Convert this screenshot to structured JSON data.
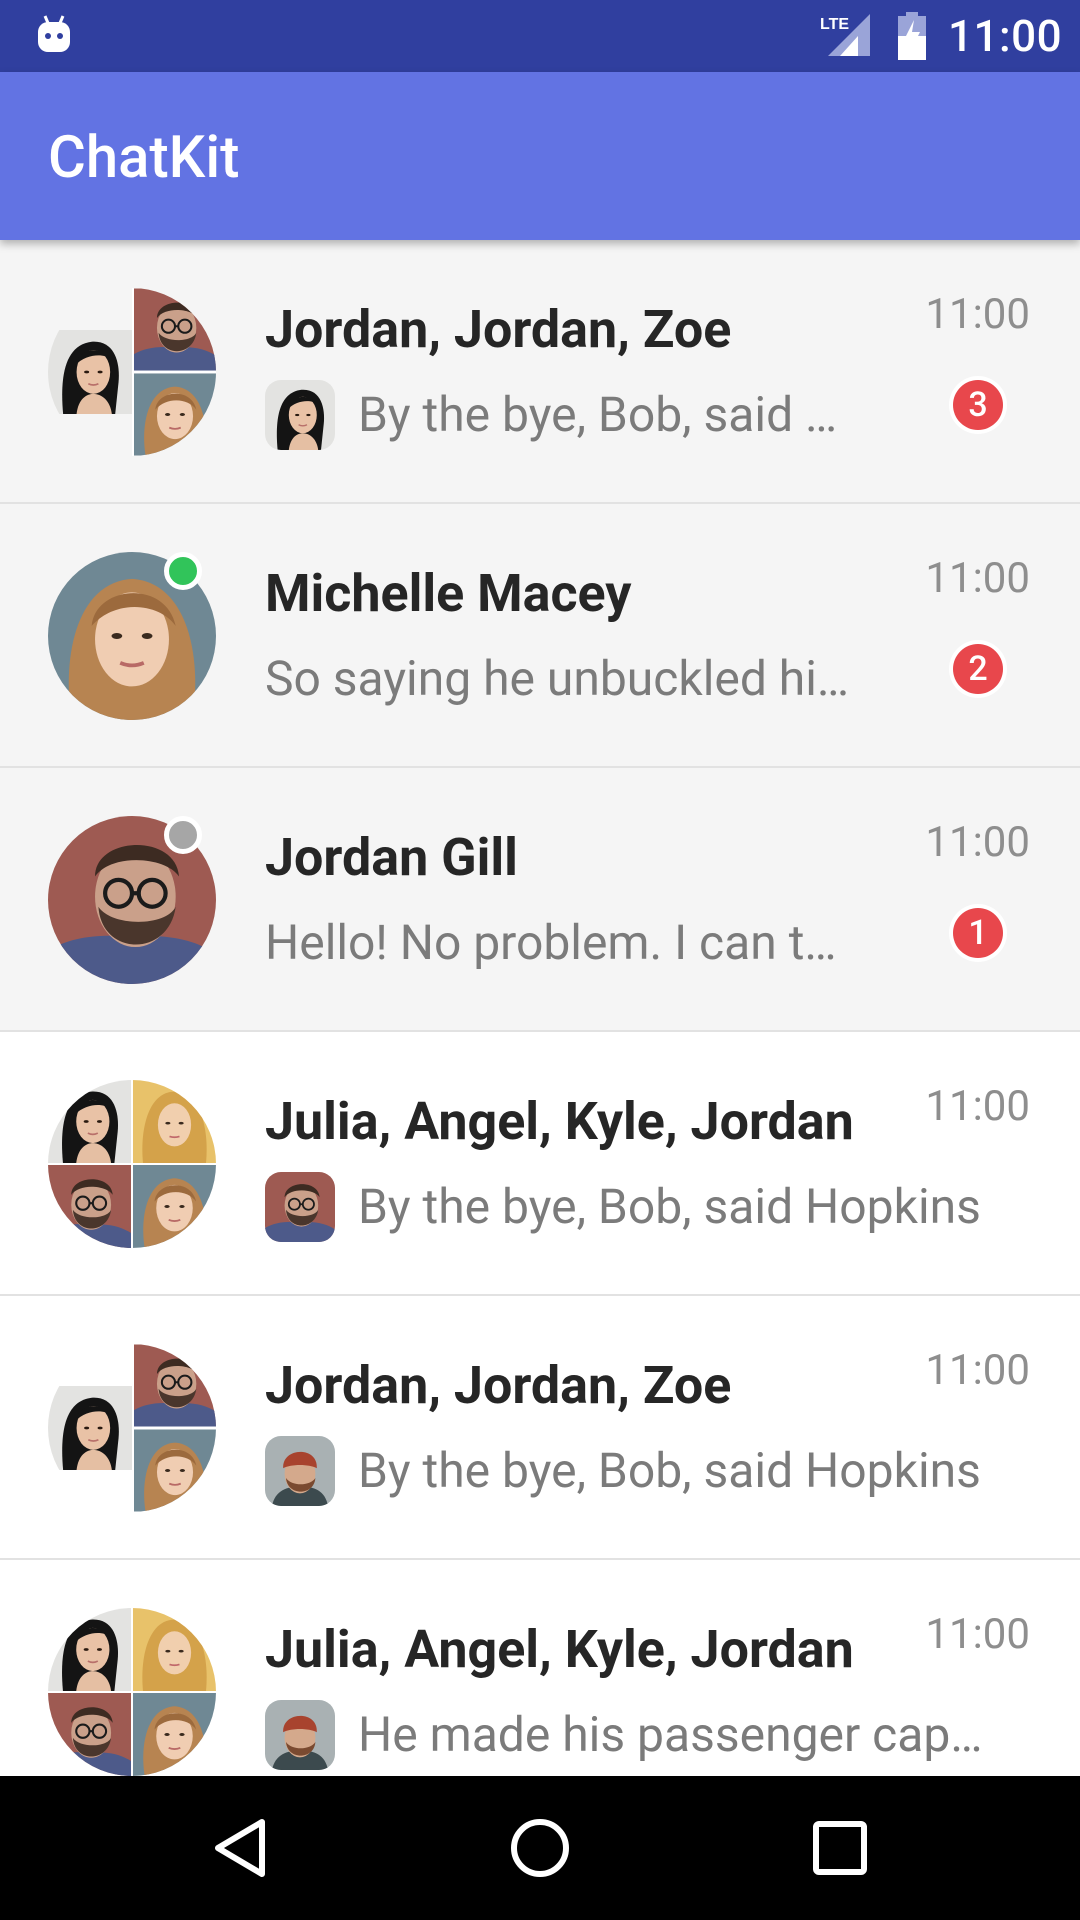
{
  "status_bar": {
    "time": "11:00",
    "network": "LTE"
  },
  "app_bar": {
    "title": "ChatKit"
  },
  "dialogs": [
    {
      "name": "Jordan, Jordan, Zoe",
      "time": "11:00",
      "message": "By the bye, Bob, said …",
      "unread": "3",
      "avatar_type": "group-3",
      "online": null,
      "msg_avatar": "asian-woman"
    },
    {
      "name": "Michelle Macey",
      "time": "11:00",
      "message": "So saying he unbuckled hi…",
      "unread": "2",
      "avatar_type": "single",
      "online": "online",
      "msg_avatar": null
    },
    {
      "name": "Jordan Gill",
      "time": "11:00",
      "message": "Hello! No problem. I can t…",
      "unread": "1",
      "avatar_type": "single",
      "online": "offline",
      "msg_avatar": null
    },
    {
      "name": "Julia, Angel, Kyle, Jordan",
      "time": "11:00",
      "message": "By the bye, Bob, said Hopkins",
      "unread": null,
      "avatar_type": "group-4",
      "online": null,
      "msg_avatar": "bearded-man"
    },
    {
      "name": "Jordan, Jordan, Zoe",
      "time": "11:00",
      "message": "By the bye, Bob, said Hopkins",
      "unread": null,
      "avatar_type": "group-3",
      "online": null,
      "msg_avatar": "red-beanie-man"
    },
    {
      "name": "Julia, Angel, Kyle, Jordan",
      "time": "11:00",
      "message": "He made his passenger cap…",
      "unread": null,
      "avatar_type": "group-4",
      "online": null,
      "msg_avatar": "red-beanie-man"
    }
  ],
  "colors": {
    "status_bar": "#303f9f",
    "app_bar": "#6273e3",
    "unread_row": "#f5f5f5",
    "badge": "#e8474c",
    "online": "#31c45a",
    "offline": "#a6a6a6"
  },
  "nav_bar": {
    "buttons": [
      "back-icon",
      "home-icon",
      "recents-icon"
    ]
  }
}
